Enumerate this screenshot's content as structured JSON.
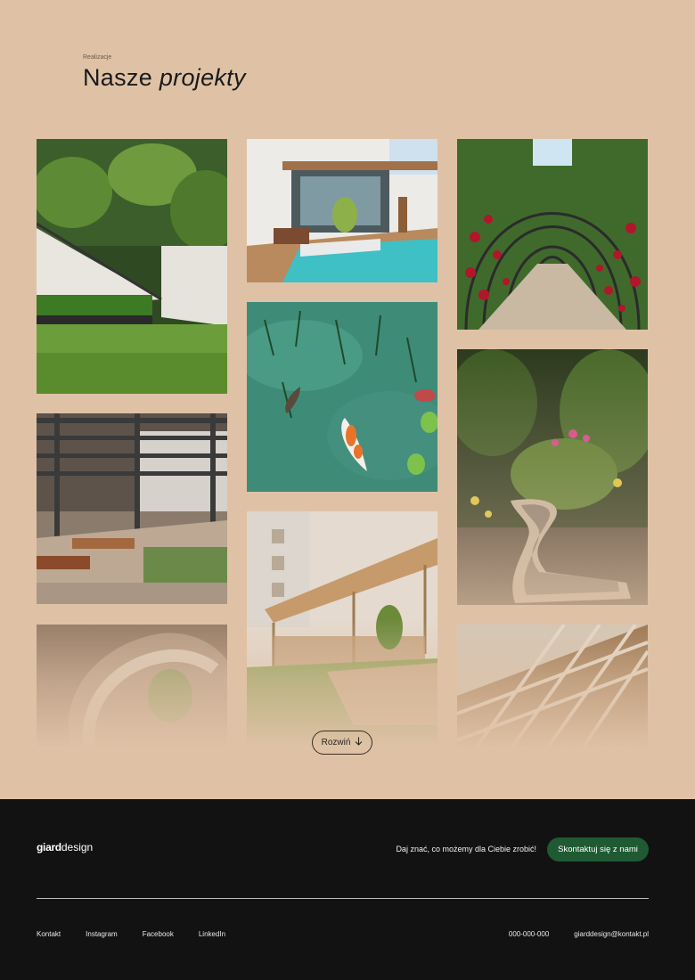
{
  "header": {
    "eyebrow": "Realizacje",
    "title_plain": "Nasze",
    "title_italic": "projekty"
  },
  "gallery": {
    "items": [
      {
        "name": "tropical-garden-stairs"
      },
      {
        "name": "pool-terrace-pergola"
      },
      {
        "name": "rose-arch-tunnel"
      },
      {
        "name": "koi-pond"
      },
      {
        "name": "steel-pergola-courtyard"
      },
      {
        "name": "garden-path-stepping"
      },
      {
        "name": "wooden-pergola-lawn"
      },
      {
        "name": "spiral-stair-faded"
      },
      {
        "name": "lattice-pergola-faded"
      }
    ],
    "expand_label": "Rozwiń",
    "expand_icon": "arrow-down-icon"
  },
  "footer": {
    "logo_bold": "giard",
    "logo_light": "design",
    "cta_text": "Daj znać, co możemy dla Ciebie zrobić!",
    "cta_button": "Skontaktuj się z nami",
    "links": [
      "Kontakt",
      "Instagram",
      "Facebook",
      "LinkedIn"
    ],
    "phone": "000-000-000",
    "email": "giarddesign@kontakt.pl"
  },
  "colors": {
    "background": "#dfc2a6",
    "footer": "#121212",
    "accent": "#1f5a32"
  }
}
